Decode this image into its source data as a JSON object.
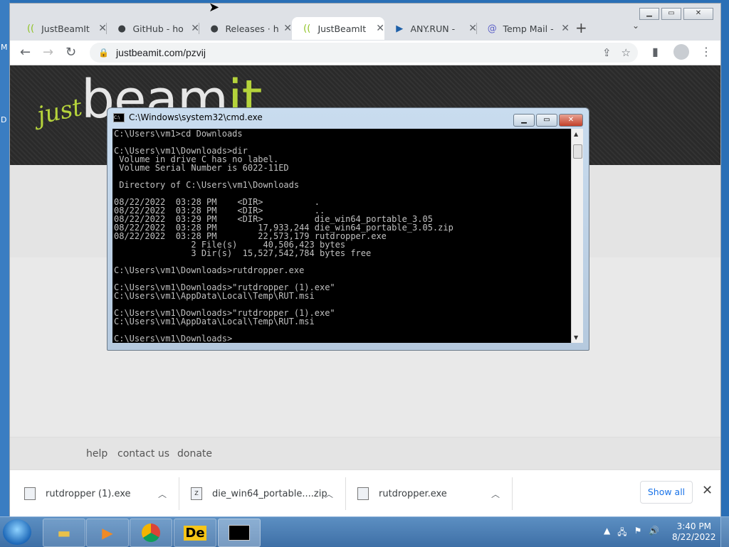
{
  "desktop": {
    "left_edge_letters": [
      "M",
      "D"
    ]
  },
  "browser": {
    "tabs": [
      {
        "label": "JustBeamIt",
        "icon": "justbeamit-icon",
        "active": false
      },
      {
        "label": "GitHub - ho",
        "icon": "github-icon",
        "active": false
      },
      {
        "label": "Releases · h",
        "icon": "github-icon",
        "active": false
      },
      {
        "label": "JustBeamIt",
        "icon": "justbeamit-icon",
        "active": true
      },
      {
        "label": "ANY.RUN -",
        "icon": "anyrun-icon",
        "active": false
      },
      {
        "label": "Temp Mail -",
        "icon": "tempmail-icon",
        "active": false
      }
    ],
    "close_glyph": "✕",
    "new_tab_glyph": "+",
    "tab_menu_glyph": "⌄",
    "url": "justbeamit.com/pzvij"
  },
  "page": {
    "logo_just": "just",
    "logo_beam": "beam",
    "logo_it": "it",
    "footer_links": [
      "help",
      "contact us",
      "donate"
    ]
  },
  "downloads": {
    "items": [
      {
        "name": "rutdropper (1).exe"
      },
      {
        "name": "die_win64_portable....zip"
      },
      {
        "name": "rutdropper.exe"
      }
    ],
    "show_all": "Show all"
  },
  "cmd": {
    "title": "C:\\Windows\\system32\\cmd.exe",
    "output": "C:\\Users\\vm1>cd Downloads\n\nC:\\Users\\vm1\\Downloads>dir\n Volume in drive C has no label.\n Volume Serial Number is 6022-11ED\n\n Directory of C:\\Users\\vm1\\Downloads\n\n08/22/2022  03:28 PM    <DIR>          .\n08/22/2022  03:28 PM    <DIR>          ..\n08/22/2022  03:29 PM    <DIR>          die_win64_portable_3.05\n08/22/2022  03:28 PM        17,933,244 die_win64_portable_3.05.zip\n08/22/2022  03:28 PM        22,573,179 rutdropper.exe\n               2 File(s)     40,506,423 bytes\n               3 Dir(s)  15,527,542,784 bytes free\n\nC:\\Users\\vm1\\Downloads>rutdropper.exe\n\nC:\\Users\\vm1\\Downloads>\"rutdropper (1).exe\"\nC:\\Users\\vm1\\AppData\\Local\\Temp\\RUT.msi\n\nC:\\Users\\vm1\\Downloads>\"rutdropper (1).exe\"\nC:\\Users\\vm1\\AppData\\Local\\Temp\\RUT.msi\n\nC:\\Users\\vm1\\Downloads>"
  },
  "taskbar": {
    "apps": [
      "explorer-icon",
      "media-player-icon",
      "chrome-icon",
      "die-icon",
      "cmd-icon"
    ],
    "die_label": "De",
    "time": "3:40 PM",
    "date": "8/22/2022"
  },
  "colors": {
    "logo_green": "#b5d33b",
    "link_blue": "#1a73e8"
  }
}
